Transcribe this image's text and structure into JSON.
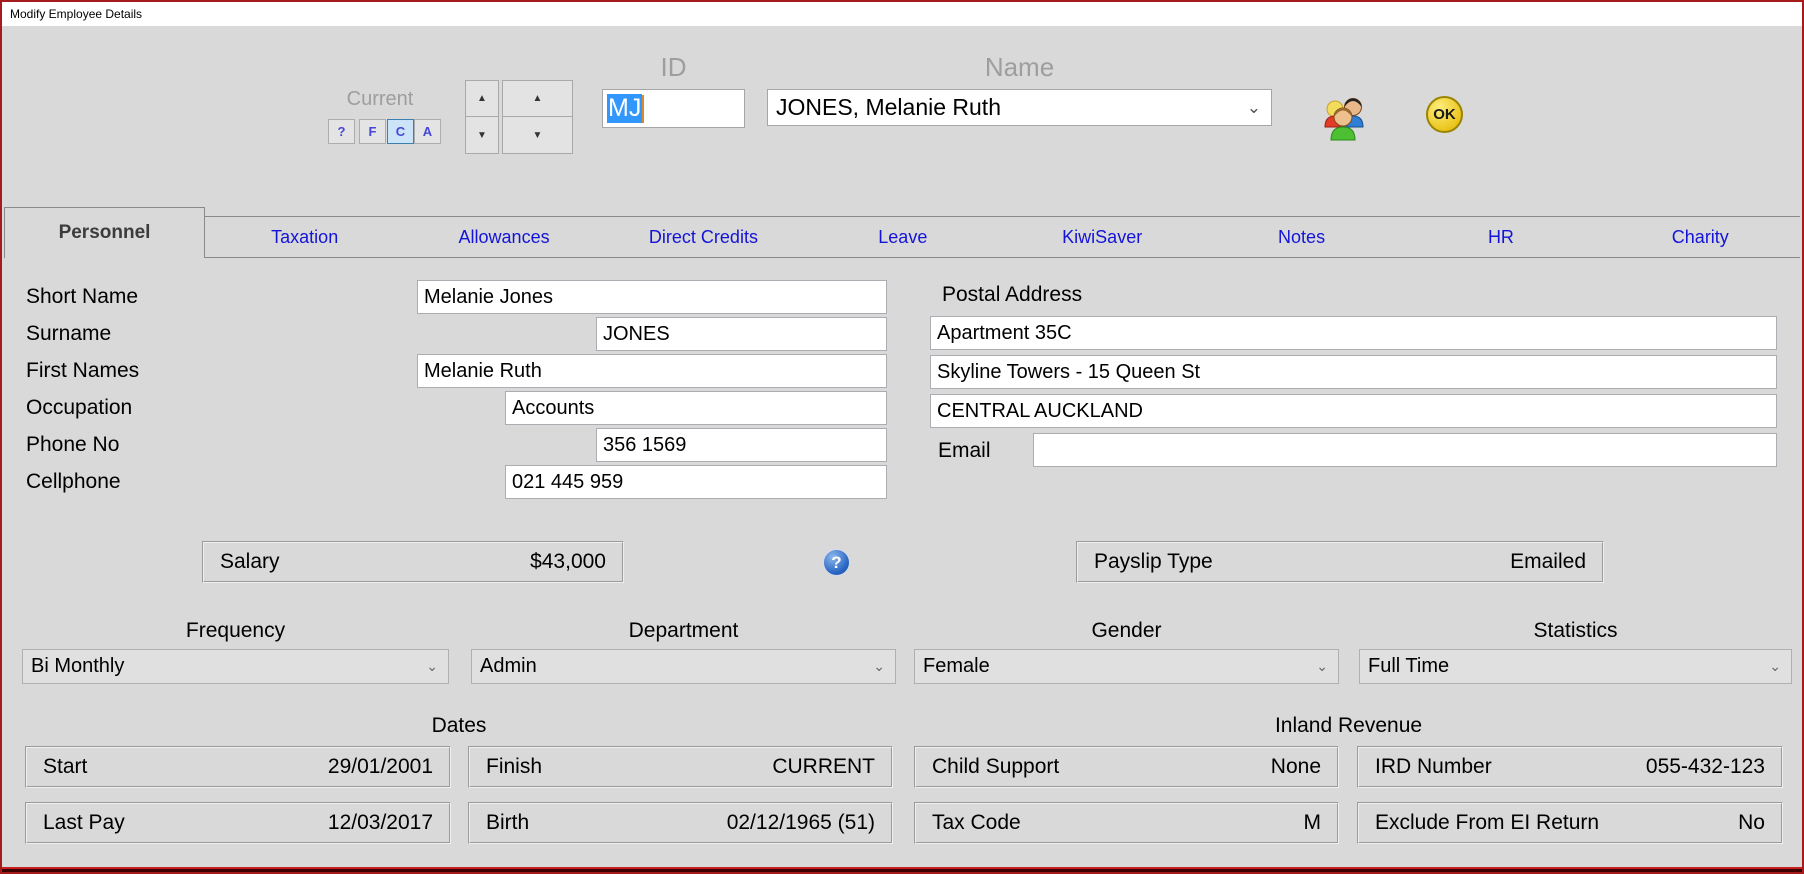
{
  "window": {
    "title": "Modify Employee Details"
  },
  "header": {
    "current_label": "Current",
    "filter_buttons": [
      {
        "label": "?",
        "selected": false
      },
      {
        "label": "F",
        "selected": false
      },
      {
        "label": "C",
        "selected": true
      },
      {
        "label": "A",
        "selected": false
      }
    ],
    "id_label": "ID",
    "id_value": "MJ",
    "name_label": "Name",
    "name_value": "JONES, Melanie Ruth",
    "ok_label": "OK"
  },
  "icons": {
    "spinner_up": "▲",
    "spinner_down": "▼",
    "dropdown_chevron": "⌄",
    "help": "?"
  },
  "tabs": [
    {
      "label": "Personnel",
      "active": true
    },
    {
      "label": "Taxation",
      "active": false
    },
    {
      "label": "Allowances",
      "active": false
    },
    {
      "label": "Direct Credits",
      "active": false
    },
    {
      "label": "Leave",
      "active": false
    },
    {
      "label": "KiwiSaver",
      "active": false
    },
    {
      "label": "Notes",
      "active": false
    },
    {
      "label": "HR",
      "active": false
    },
    {
      "label": "Charity",
      "active": false
    }
  ],
  "personnel": {
    "fields": [
      {
        "label": "Short Name",
        "value": "Melanie Jones"
      },
      {
        "label": "Surname",
        "value": "JONES"
      },
      {
        "label": "First Names",
        "value": "Melanie Ruth"
      },
      {
        "label": "Occupation",
        "value": "Accounts"
      },
      {
        "label": "Phone No",
        "value": "356 1569"
      },
      {
        "label": "Cellphone",
        "value": "021 445 959"
      }
    ],
    "postal": {
      "label": "Postal Address",
      "line1": "Apartment 35C",
      "line2": "Skyline Towers - 15 Queen St",
      "line3": "CENTRAL AUCKLAND",
      "email_label": "Email",
      "email_value": ""
    },
    "salary": {
      "label": "Salary",
      "value": "$43,000"
    },
    "payslip": {
      "label": "Payslip Type",
      "value": "Emailed"
    },
    "dropdowns": [
      {
        "label": "Frequency",
        "value": "Bi Monthly"
      },
      {
        "label": "Department",
        "value": "Admin"
      },
      {
        "label": "Gender",
        "value": "Female"
      },
      {
        "label": "Statistics",
        "value": "Full Time"
      }
    ],
    "dates": {
      "header": "Dates",
      "items": [
        {
          "label": "Start",
          "value": "29/01/2001"
        },
        {
          "label": "Finish",
          "value": "CURRENT"
        },
        {
          "label": "Last Pay",
          "value": "12/03/2017"
        },
        {
          "label": "Birth",
          "value": "02/12/1965 (51)"
        }
      ]
    },
    "inland_revenue": {
      "header": "Inland Revenue",
      "items": [
        {
          "label": "Child Support",
          "value": "None"
        },
        {
          "label": "IRD Number",
          "value": "055-432-123"
        },
        {
          "label": "Tax Code",
          "value": "M"
        },
        {
          "label": "Exclude From EI Return",
          "value": "No"
        }
      ]
    }
  },
  "colors": {
    "background": "#d9d9d9",
    "window_border": "#a51a1a",
    "selection_blue": "#3297fd",
    "tab_link_blue": "#1414d8",
    "ok_yellow": "#ecc51e",
    "help_blue": "#2a66c4",
    "selected_filter_bg": "#cce4f7"
  }
}
